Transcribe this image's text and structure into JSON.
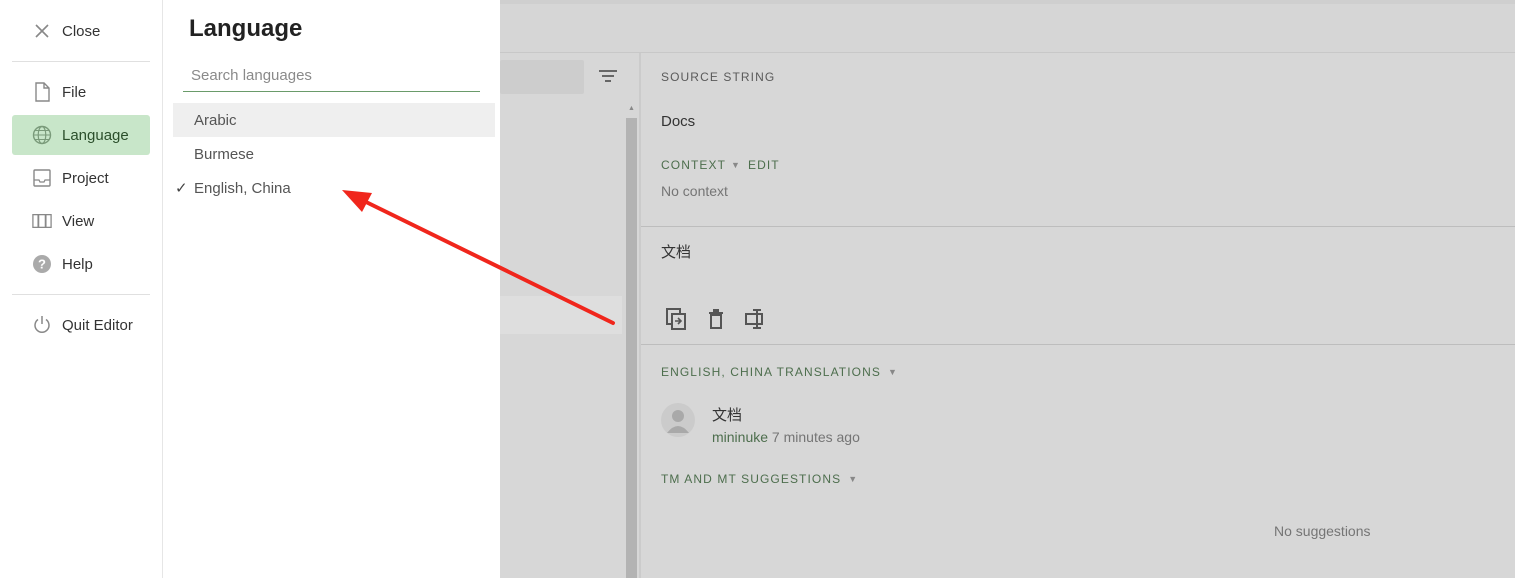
{
  "nav": {
    "close": "Close",
    "file": "File",
    "language": "Language",
    "project": "Project",
    "view": "View",
    "help": "Help",
    "quit": "Quit Editor"
  },
  "language_panel": {
    "title": "Language",
    "search_placeholder": "Search languages",
    "languages": [
      "Arabic",
      "Burmese",
      "English, China"
    ],
    "selected": "English, China"
  },
  "editor": {
    "source_label": "SOURCE STRING",
    "source_text": "Docs",
    "context_label": "CONTEXT",
    "edit_label": "EDIT",
    "no_context": "No context",
    "translation_text": "文档",
    "translations_label": "ENGLISH, CHINA TRANSLATIONS",
    "history_text": "文档",
    "history_user": "mininuke",
    "history_time": "7 minutes ago",
    "tm_label": "TM AND MT SUGGESTIONS",
    "no_suggestions": "No suggestions"
  },
  "colors": {
    "accent": "#c8e6c9",
    "accent_text": "#2b4f2b",
    "green_label": "#4d6e4d",
    "arrow": "#f0261c"
  },
  "icons": [
    "close-icon",
    "file-icon",
    "globe-icon",
    "inbox-icon",
    "view-icon",
    "help-icon",
    "power-icon",
    "filter-icon",
    "copy-icon",
    "trash-icon",
    "insert-icon",
    "check-icon",
    "user-icon"
  ]
}
